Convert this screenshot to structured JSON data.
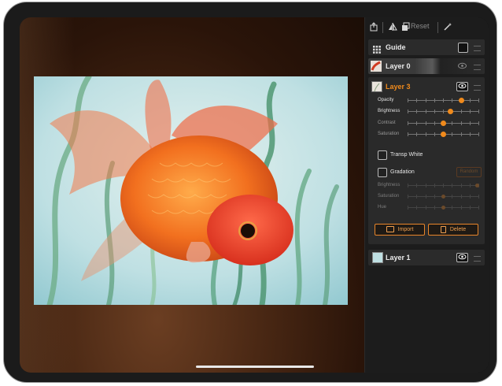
{
  "toolbar": {
    "reset_label": "Reset",
    "icons": [
      "export-icon",
      "flip-icon",
      "copy-icon",
      "magic-wand-icon"
    ]
  },
  "layers": {
    "guide": {
      "label": "Guide"
    },
    "layer0": {
      "label": "Layer 0"
    },
    "layer3": {
      "label": "Layer 3",
      "accent": "#f08a1c",
      "sliders": [
        {
          "label": "Opacity",
          "value": 0.75,
          "enabled": true
        },
        {
          "label": "Brightness",
          "value": 0.6,
          "enabled": true
        },
        {
          "label": "Contrast",
          "value": 0.5,
          "enabled": true
        },
        {
          "label": "Saturation",
          "value": 0.5,
          "enabled": true
        }
      ],
      "transp_white_label": "Transp White",
      "gradation_label": "Gradation",
      "random_label": "Random",
      "gradation_sliders": [
        {
          "label": "Brightness",
          "value": 0.98
        },
        {
          "label": "Saturation",
          "value": 0.5
        },
        {
          "label": "Hue",
          "value": 0.5
        }
      ],
      "import_label": "Import",
      "delete_label": "Delete"
    },
    "layer1": {
      "label": "Layer 1"
    }
  }
}
